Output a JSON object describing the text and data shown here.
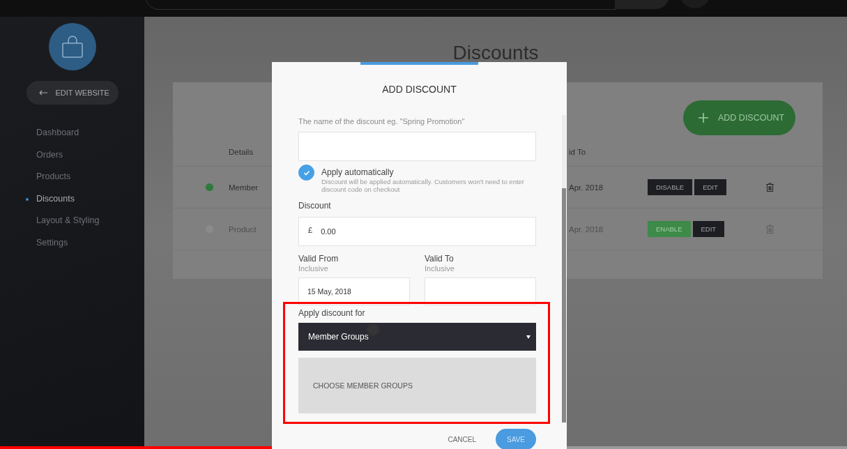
{
  "sidebar": {
    "back_button": "EDIT WEBSITE",
    "items": [
      {
        "label": "Dashboard",
        "selected": false
      },
      {
        "label": "Orders",
        "selected": false
      },
      {
        "label": "Products",
        "selected": false
      },
      {
        "label": "Discounts",
        "selected": true
      },
      {
        "label": "Layout & Styling",
        "selected": false
      },
      {
        "label": "Settings",
        "selected": false
      }
    ]
  },
  "page": {
    "title": "Discounts",
    "add_button": "ADD DISCOUNT",
    "columns": [
      "Details",
      "id To"
    ],
    "rows": [
      {
        "details": "Member",
        "valid_to": "Apr. 2018",
        "enabled": true,
        "toggle": "DISABLE",
        "edit": "EDIT"
      },
      {
        "details": "Product",
        "valid_to": "Apr. 2018",
        "enabled": false,
        "toggle": "ENABLE",
        "edit": "EDIT"
      }
    ]
  },
  "dialog": {
    "title": "ADD DISCOUNT",
    "name_hint": "The name of the discount eg. \"Spring Promotion\"",
    "apply_automatically": {
      "label": "Apply automatically",
      "hint": "Discount will be applied automatically. Customers won't need to enter discount code on checkout",
      "checked": true
    },
    "discount": {
      "label": "Discount",
      "currency": "£",
      "value": "0.00"
    },
    "valid_from": {
      "label": "Valid From",
      "hint": "Inclusive",
      "value": "15 May, 2018"
    },
    "valid_to": {
      "label": "Valid To",
      "hint": "Inclusive"
    },
    "apply_for": {
      "label": "Apply discount for",
      "value": "Member Groups"
    },
    "choose_button": "CHOOSE MEMBER GROUPS",
    "cancel": "CANCEL",
    "save": "SAVE"
  },
  "video_progress": {
    "level": 0.34
  }
}
